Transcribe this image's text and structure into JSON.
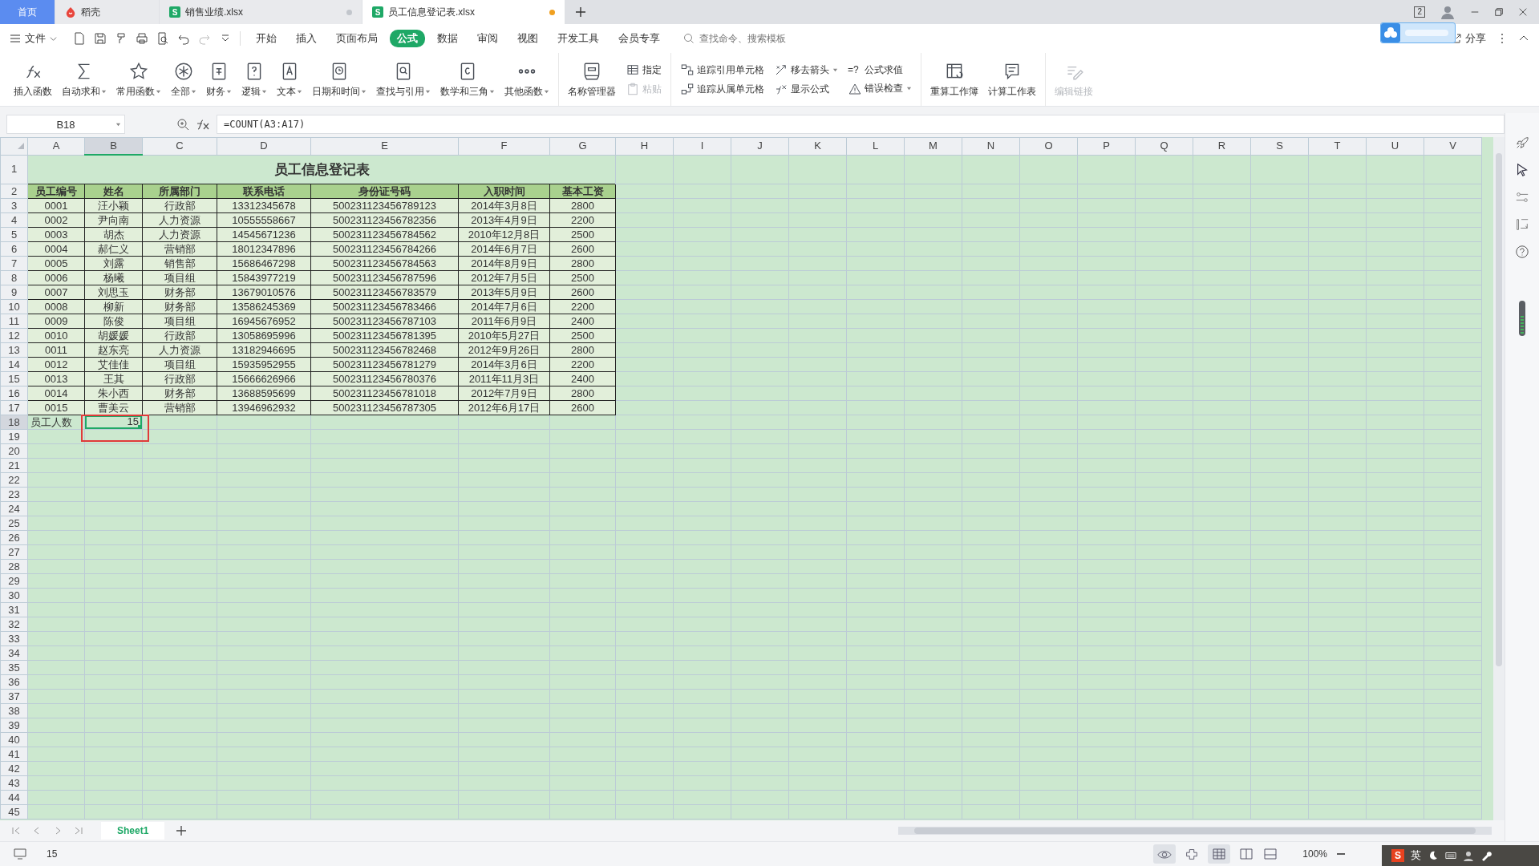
{
  "tabs": [
    {
      "kind": "home",
      "label": "首页",
      "selected": false
    },
    {
      "kind": "daoke",
      "label": "稻壳",
      "selected": false
    },
    {
      "kind": "sheet",
      "badge": "S",
      "label": "销售业绩.xlsx",
      "selected": false,
      "modified": false
    },
    {
      "kind": "sheet",
      "badge": "S",
      "label": "员工信息登记表.xlsx",
      "selected": true,
      "modified": true
    }
  ],
  "window_count": "2",
  "menu": {
    "file": "文件",
    "tabs": [
      {
        "label": "开始",
        "selected": false
      },
      {
        "label": "插入",
        "selected": false
      },
      {
        "label": "页面布局",
        "selected": false
      },
      {
        "label": "公式",
        "selected": true
      },
      {
        "label": "数据",
        "selected": false
      },
      {
        "label": "审阅",
        "selected": false
      },
      {
        "label": "视图",
        "selected": false
      },
      {
        "label": "开发工具",
        "selected": false
      },
      {
        "label": "会员专享",
        "selected": false
      }
    ],
    "search": {
      "placeholder": "查找命令、搜索模板"
    },
    "share": "分享"
  },
  "ribbon": [
    {
      "items": [
        {
          "kind": "large",
          "label": "插入函数",
          "dropdown": false,
          "disabled": false
        },
        {
          "kind": "large",
          "label": "自动求和",
          "dropdown": true,
          "disabled": false
        },
        {
          "kind": "large",
          "label": "常用函数",
          "dropdown": true,
          "disabled": false
        },
        {
          "kind": "large",
          "label": "全部",
          "dropdown": true,
          "disabled": false
        },
        {
          "kind": "large",
          "label": "财务",
          "dropdown": true,
          "disabled": false
        },
        {
          "kind": "large",
          "label": "逻辑",
          "dropdown": true,
          "disabled": false
        },
        {
          "kind": "large",
          "label": "文本",
          "dropdown": true,
          "disabled": false
        },
        {
          "kind": "large",
          "label": "日期和时间",
          "dropdown": true,
          "disabled": false
        },
        {
          "kind": "large",
          "label": "查找与引用",
          "dropdown": true,
          "disabled": false
        },
        {
          "kind": "large",
          "label": "数学和三角",
          "dropdown": true,
          "disabled": false
        },
        {
          "kind": "large",
          "label": "其他函数",
          "dropdown": true,
          "disabled": false
        }
      ]
    },
    {
      "items": [
        {
          "kind": "large",
          "label": "名称管理器",
          "dropdown": false,
          "disabled": false
        },
        {
          "kind": "stack",
          "items": [
            {
              "label": "指定",
              "dropdown": false,
              "disabled": false
            },
            {
              "label": "粘贴",
              "dropdown": false,
              "disabled": true
            }
          ]
        }
      ]
    },
    {
      "items": [
        {
          "kind": "stack",
          "items": [
            {
              "label": "追踪引用单元格",
              "dropdown": false,
              "disabled": false
            },
            {
              "label": "追踪从属单元格",
              "dropdown": false,
              "disabled": false
            }
          ]
        },
        {
          "kind": "stack",
          "items": [
            {
              "label": "移去箭头",
              "dropdown": true,
              "disabled": false
            },
            {
              "label": "显示公式",
              "dropdown": false,
              "disabled": false
            }
          ]
        },
        {
          "kind": "stack",
          "items": [
            {
              "glyph": "=?",
              "label": "公式求值",
              "dropdown": false,
              "disabled": false
            },
            {
              "label": "错误检查",
              "dropdown": true,
              "disabled": false
            }
          ]
        }
      ]
    },
    {
      "items": [
        {
          "kind": "large",
          "label": "重算工作簿",
          "dropdown": false,
          "disabled": false
        },
        {
          "kind": "large",
          "label": "计算工作表",
          "dropdown": false,
          "disabled": false
        }
      ]
    },
    {
      "items": [
        {
          "kind": "large",
          "label": "编辑链接",
          "dropdown": false,
          "disabled": true
        }
      ]
    }
  ],
  "formula_bar": {
    "cell": "B18",
    "formula": "=COUNT(A3:A17)"
  },
  "sheet": {
    "columns": [
      {
        "label": "A",
        "selected": false
      },
      {
        "label": "B",
        "selected": true
      },
      {
        "label": "C",
        "selected": false
      },
      {
        "label": "D",
        "selected": false
      },
      {
        "label": "E",
        "selected": false
      },
      {
        "label": "F",
        "selected": false
      },
      {
        "label": "G",
        "selected": false
      },
      {
        "label": "H",
        "selected": false
      },
      {
        "label": "I",
        "selected": false
      },
      {
        "label": "J",
        "selected": false
      },
      {
        "label": "K",
        "selected": false
      },
      {
        "label": "L",
        "selected": false
      },
      {
        "label": "M",
        "selected": false
      },
      {
        "label": "N",
        "selected": false
      },
      {
        "label": "O",
        "selected": false
      },
      {
        "label": "P",
        "selected": false
      },
      {
        "label": "Q",
        "selected": false
      },
      {
        "label": "R",
        "selected": false
      },
      {
        "label": "S",
        "selected": false
      },
      {
        "label": "T",
        "selected": false
      },
      {
        "label": "U",
        "selected": false
      },
      {
        "label": "V",
        "selected": false
      }
    ],
    "rows": [
      {
        "label": "1",
        "selected": false
      },
      {
        "label": "2",
        "selected": false
      },
      {
        "label": "3",
        "selected": false
      },
      {
        "label": "4",
        "selected": false
      },
      {
        "label": "5",
        "selected": false
      },
      {
        "label": "6",
        "selected": false
      },
      {
        "label": "7",
        "selected": false
      },
      {
        "label": "8",
        "selected": false
      },
      {
        "label": "9",
        "selected": false
      },
      {
        "label": "10",
        "selected": false
      },
      {
        "label": "11",
        "selected": false
      },
      {
        "label": "12",
        "selected": false
      },
      {
        "label": "13",
        "selected": false
      },
      {
        "label": "14",
        "selected": false
      },
      {
        "label": "15",
        "selected": false
      },
      {
        "label": "16",
        "selected": false
      },
      {
        "label": "17",
        "selected": false
      },
      {
        "label": "18",
        "selected": true
      },
      {
        "label": "19",
        "selected": false
      },
      {
        "label": "20",
        "selected": false
      },
      {
        "label": "21",
        "selected": false
      },
      {
        "label": "22",
        "selected": false
      },
      {
        "label": "23",
        "selected": false
      },
      {
        "label": "24",
        "selected": false
      },
      {
        "label": "25",
        "selected": false
      },
      {
        "label": "26",
        "selected": false
      },
      {
        "label": "27",
        "selected": false
      },
      {
        "label": "28",
        "selected": false
      },
      {
        "label": "29",
        "selected": false
      },
      {
        "label": "30",
        "selected": false
      },
      {
        "label": "31",
        "selected": false
      },
      {
        "label": "32",
        "selected": false
      },
      {
        "label": "33",
        "selected": false
      },
      {
        "label": "34",
        "selected": false
      },
      {
        "label": "35",
        "selected": false
      },
      {
        "label": "36",
        "selected": false
      },
      {
        "label": "37",
        "selected": false
      },
      {
        "label": "38",
        "selected": false
      },
      {
        "label": "39",
        "selected": false
      },
      {
        "label": "40",
        "selected": false
      },
      {
        "label": "41",
        "selected": false
      },
      {
        "label": "42",
        "selected": false
      },
      {
        "label": "43",
        "selected": false
      },
      {
        "label": "44",
        "selected": false
      },
      {
        "label": "45",
        "selected": false
      }
    ],
    "title": "员工信息登记表",
    "header": [
      "员工编号",
      "姓名",
      "所属部门",
      "联系电话",
      "身份证号码",
      "入职时间",
      "基本工资"
    ],
    "records": [
      [
        "0001",
        "汪小颖",
        "行政部",
        "13312345678",
        "500231123456789123",
        "2014年3月8日",
        "2800"
      ],
      [
        "0002",
        "尹向南",
        "人力资源",
        "10555558667",
        "500231123456782356",
        "2013年4月9日",
        "2200"
      ],
      [
        "0003",
        "胡杰",
        "人力资源",
        "14545671236",
        "500231123456784562",
        "2010年12月8日",
        "2500"
      ],
      [
        "0004",
        "郝仁义",
        "营销部",
        "18012347896",
        "500231123456784266",
        "2014年6月7日",
        "2600"
      ],
      [
        "0005",
        "刘露",
        "销售部",
        "15686467298",
        "500231123456784563",
        "2014年8月9日",
        "2800"
      ],
      [
        "0006",
        "杨曦",
        "项目组",
        "15843977219",
        "500231123456787596",
        "2012年7月5日",
        "2500"
      ],
      [
        "0007",
        "刘思玉",
        "财务部",
        "13679010576",
        "500231123456783579",
        "2013年5月9日",
        "2600"
      ],
      [
        "0008",
        "柳新",
        "财务部",
        "13586245369",
        "500231123456783466",
        "2014年7月6日",
        "2200"
      ],
      [
        "0009",
        "陈俊",
        "项目组",
        "16945676952",
        "500231123456787103",
        "2011年6月9日",
        "2400"
      ],
      [
        "0010",
        "胡媛媛",
        "行政部",
        "13058695996",
        "500231123456781395",
        "2010年5月27日",
        "2500"
      ],
      [
        "0011",
        "赵东亮",
        "人力资源",
        "13182946695",
        "500231123456782468",
        "2012年9月26日",
        "2800"
      ],
      [
        "0012",
        "艾佳佳",
        "项目组",
        "15935952955",
        "500231123456781279",
        "2014年3月6日",
        "2200"
      ],
      [
        "0013",
        "王其",
        "行政部",
        "15666626966",
        "500231123456780376",
        "2011年11月3日",
        "2400"
      ],
      [
        "0014",
        "朱小西",
        "财务部",
        "13688595699",
        "500231123456781018",
        "2012年7月9日",
        "2800"
      ],
      [
        "0015",
        "曹美云",
        "营销部",
        "13946962932",
        "500231123456787305",
        "2012年6月17日",
        "2600"
      ]
    ],
    "footer": {
      "label": "员工人数",
      "value": "15",
      "active": true,
      "highlighted": true
    }
  },
  "sheet_tabs": [
    {
      "label": "Sheet1",
      "selected": true
    }
  ],
  "status_bar": {
    "value": "15",
    "zoom": "100%"
  },
  "ime": {
    "logo": "S",
    "mode": "英"
  }
}
